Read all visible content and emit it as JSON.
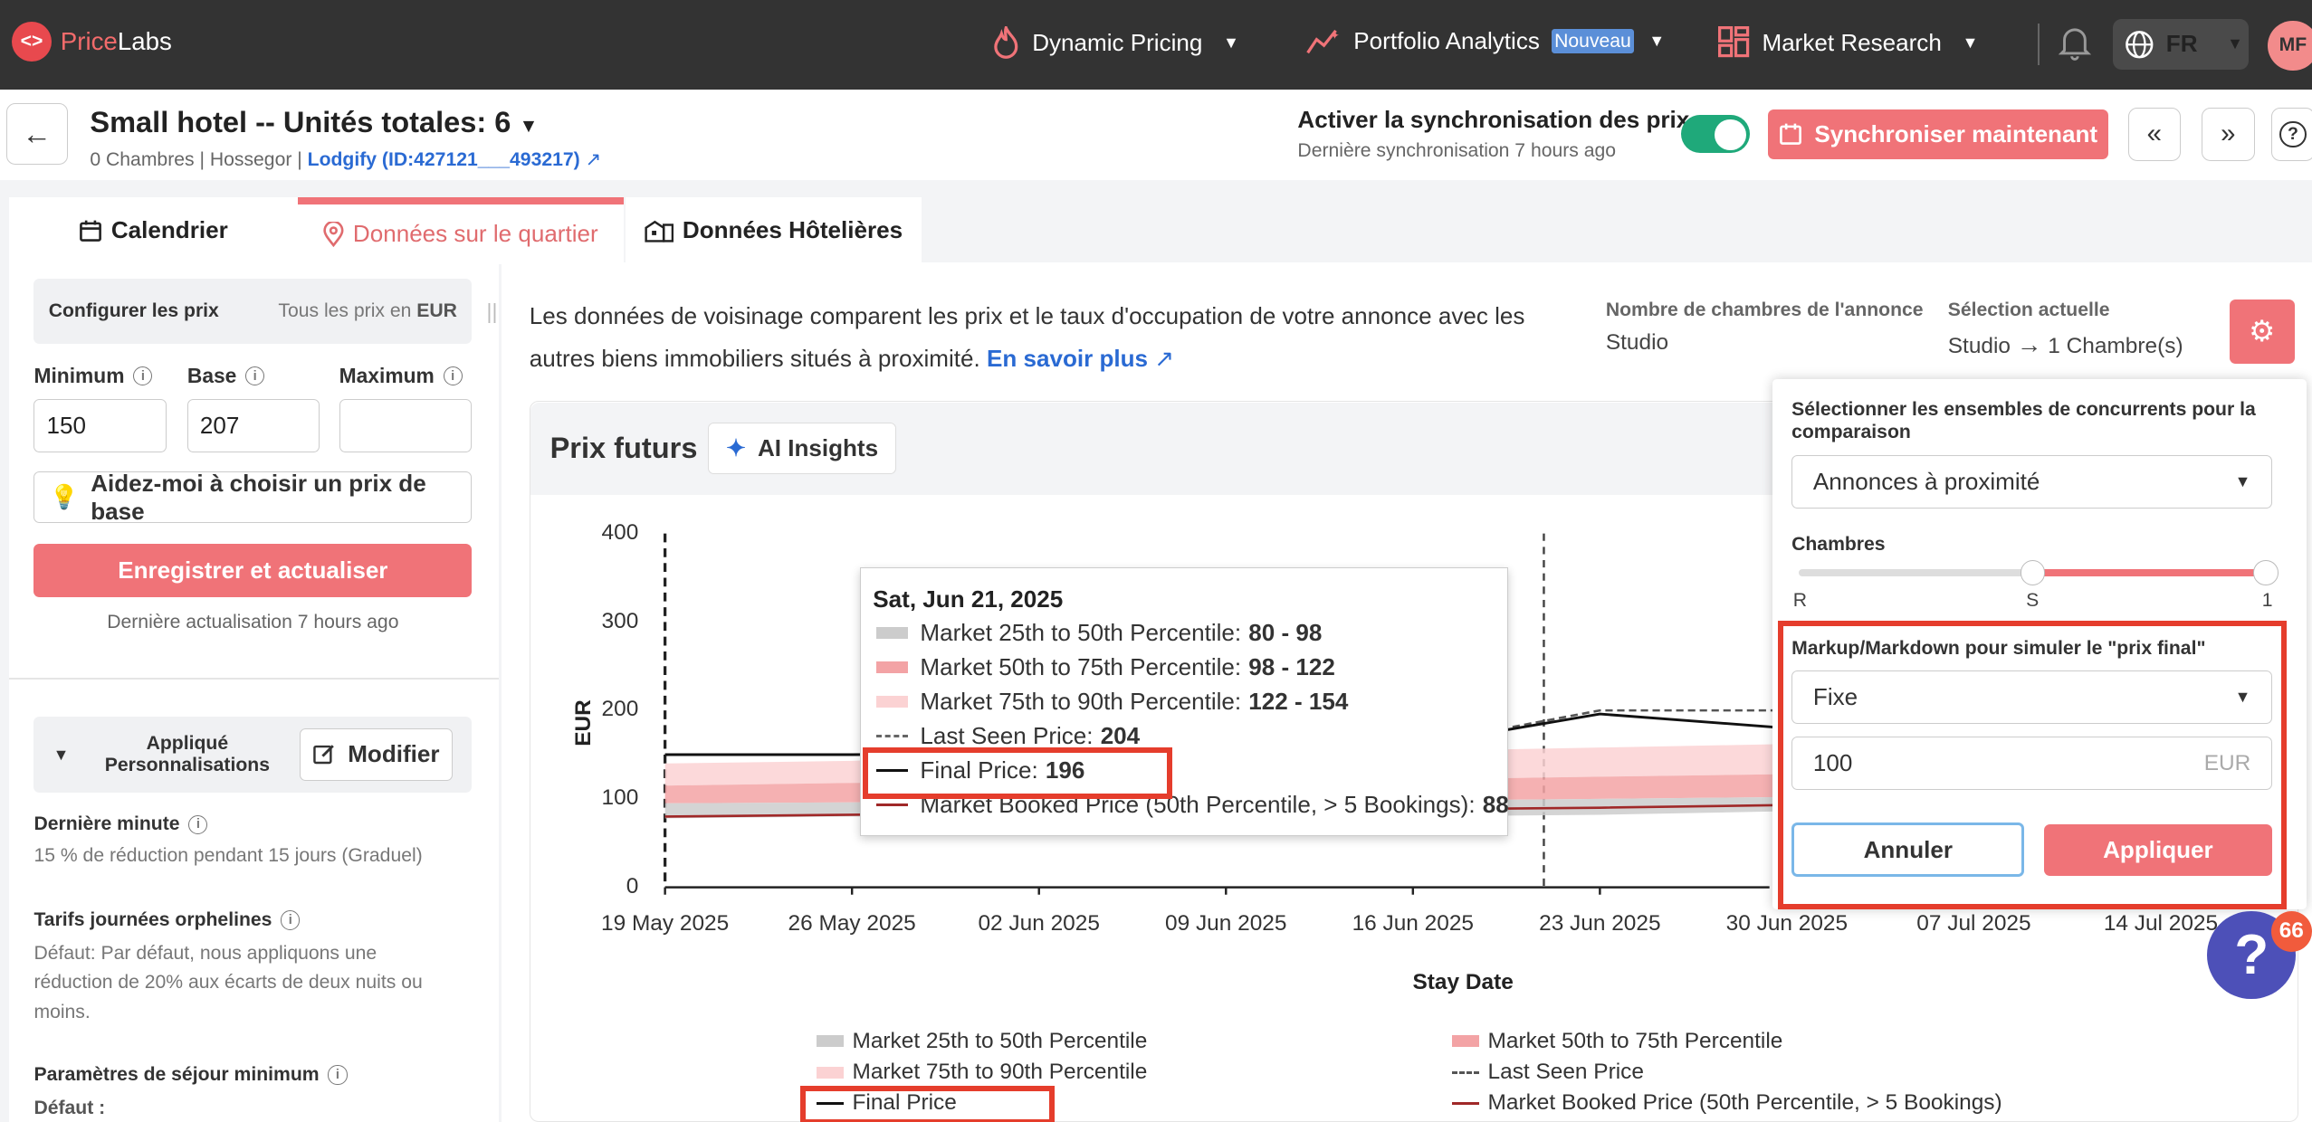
{
  "topbar": {
    "brand_price": "Price",
    "brand_labs": "Labs",
    "nav": [
      {
        "label": "Dynamic Pricing"
      },
      {
        "label": "Portfolio Analytics",
        "badge": "Nouveau"
      },
      {
        "label": "Market Research"
      }
    ],
    "language": "FR",
    "avatar": "MF"
  },
  "header": {
    "title": "Small hotel -- Unités totales: 6",
    "subtitle": "0 Chambres | Hossegor | ",
    "listing_link": "Lodgify (ID:427121___493217)",
    "sync_title": "Activer la synchronisation des prix",
    "sync_subtitle": "Dernière synchronisation 7 hours ago",
    "sync_enabled": true,
    "sync_button": "Synchroniser maintenant"
  },
  "tabs": [
    {
      "label": "Calendrier",
      "active": false
    },
    {
      "label": "Données sur le quartier",
      "active": true
    },
    {
      "label": "Données Hôtelières",
      "active": false
    }
  ],
  "sidebar": {
    "config_label": "Configurer les prix",
    "config_currency_prefix": "Tous les prix en",
    "config_currency": "EUR",
    "min_label": "Minimum",
    "base_label": "Base",
    "max_label": "Maximum",
    "min_value": "150",
    "base_value": "207",
    "max_value": "",
    "help_button": "Aidez-moi à choisir un prix de base",
    "save_button": "Enregistrer et actualiser",
    "last_update": "Dernière actualisation 7 hours ago",
    "customizations_label": "Appliqué Personnalisations",
    "modify_button": "Modifier",
    "sections": [
      {
        "title": "Dernière minute",
        "text": "15 % de réduction pendant 15 jours (Graduel)"
      },
      {
        "title": "Tarifs journées orphelines",
        "text": "Défaut: Par défaut, nous appliquons une réduction de 20% aux écarts de deux nuits ou moins."
      },
      {
        "title": "Paramètres de séjour minimum",
        "text": "Défaut :"
      }
    ]
  },
  "main": {
    "intro": "Les données de voisinage comparent les prix et le taux d'occupation de votre annonce avec les autres biens immobiliers situés à proximité.",
    "learn_more": "En savoir plus",
    "rooms_label": "Nombre de chambres de l'annonce",
    "rooms_value": "Studio",
    "selection_label": "Sélection actuelle",
    "selection_from": "Studio",
    "selection_to": "1 Chambre(s)",
    "chart_title": "Prix futurs",
    "ai_button": "AI Insights"
  },
  "chart_data": {
    "type": "line",
    "ylabel": "EUR",
    "xlabel": "Stay Date",
    "ylim": [
      0,
      400
    ],
    "y_ticks": [
      "400",
      "300",
      "200",
      "100",
      "0"
    ],
    "x_ticks": [
      "19 May 2025",
      "26 May 2025",
      "02 Jun 2025",
      "09 Jun 2025",
      "16 Jun 2025",
      "23 Jun 2025",
      "30 Jun 2025",
      "07 Jul 2025",
      "14 Jul 2025"
    ],
    "x": [
      "19 May 2025",
      "26 May 2025",
      "02 Jun 2025",
      "09 Jun 2025",
      "16 Jun 2025",
      "23 Jun 2025",
      "30 Jun 2025"
    ],
    "series": [
      {
        "name": "Market 25th to 50th Percentile",
        "values": [
          [
            78,
            95
          ],
          [
            80,
            96
          ],
          [
            80,
            97
          ],
          [
            80,
            98
          ],
          [
            80,
            98
          ],
          [
            82,
            100
          ],
          [
            86,
            102
          ]
        ]
      },
      {
        "name": "Market 50th to 75th Percentile",
        "values": [
          [
            95,
            115
          ],
          [
            96,
            118
          ],
          [
            97,
            120
          ],
          [
            98,
            122
          ],
          [
            98,
            122
          ],
          [
            100,
            125
          ],
          [
            102,
            128
          ]
        ]
      },
      {
        "name": "Market 75th to 90th Percentile",
        "values": [
          [
            115,
            140
          ],
          [
            118,
            143
          ],
          [
            120,
            150
          ],
          [
            122,
            154
          ],
          [
            122,
            154
          ],
          [
            125,
            158
          ],
          [
            128,
            162
          ]
        ]
      },
      {
        "name": "Last Seen Price",
        "values": [
          150,
          150,
          152,
          156,
          160,
          200,
          200
        ]
      },
      {
        "name": "Final Price",
        "values": [
          150,
          150,
          152,
          156,
          160,
          196,
          180
        ]
      },
      {
        "name": "Market Booked Price (50th Percentile, > 5 Bookings)",
        "values": [
          80,
          82,
          84,
          86,
          88,
          90,
          93
        ]
      }
    ],
    "tooltip": {
      "date": "Sat, Jun 21, 2025",
      "rows": [
        {
          "label": "Market 25th to 50th Percentile",
          "value": "80 - 98",
          "color": "#cccccc"
        },
        {
          "label": "Market 50th to 75th Percentile",
          "value": "98 - 122",
          "color": "#f3a3a5"
        },
        {
          "label": "Market 75th to 90th Percentile",
          "value": "122 - 154",
          "color": "#fbd2d3"
        },
        {
          "label": "Last Seen Price",
          "value": "204",
          "color": "#666666"
        },
        {
          "label": "Final Price",
          "value": "196",
          "color": "#111111"
        },
        {
          "label": "Market Booked Price (50th Percentile, > 5 Bookings)",
          "value": "88",
          "color": "#a02828"
        }
      ]
    },
    "legend": [
      "Market 25th to 50th Percentile",
      "Market 50th to 75th Percentile",
      "Market 75th to 90th Percentile",
      "Last Seen Price",
      "Final Price",
      "Market Booked Price (50th Percentile, > 5 Bookings)"
    ]
  },
  "panel": {
    "comp_label": "Sélectionner les ensembles de concurrents pour la comparaison",
    "comp_value": "Annonces à proximité",
    "rooms_label": "Chambres",
    "slider_labels": [
      "R",
      "S",
      "1"
    ],
    "markup_label": "Markup/Markdown pour simuler le \"prix final\"",
    "markup_type": "Fixe",
    "markup_value": "100",
    "markup_unit": "EUR",
    "cancel": "Annuler",
    "apply": "Appliquer"
  },
  "help_badge": "66",
  "colors": {
    "accent": "#f07378",
    "topbar": "#333333",
    "link": "#2a6ad3",
    "highlight": "#e53d2c",
    "toggle": "#1fa97a"
  }
}
